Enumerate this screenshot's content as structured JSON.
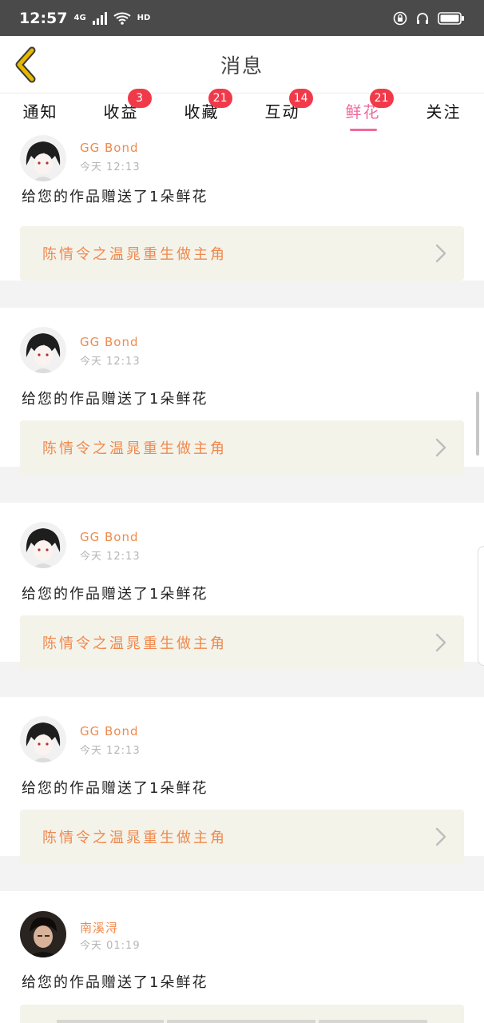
{
  "status_bar": {
    "time": "12:57",
    "network": "4G",
    "hd": "HD"
  },
  "header": {
    "title": "消息"
  },
  "tabs": [
    {
      "label": "通知",
      "badge": ""
    },
    {
      "label": "收益",
      "badge": "3"
    },
    {
      "label": "收藏",
      "badge": "21"
    },
    {
      "label": "互动",
      "badge": "14"
    },
    {
      "label": "鲜花",
      "badge": "21",
      "active": true
    },
    {
      "label": "关注",
      "badge": ""
    }
  ],
  "messages": [
    {
      "name": "GG Bond",
      "time": "今天 12:13",
      "text": "给您的作品赠送了1朵鲜花",
      "work": "陈情令之温晁重生做主角"
    },
    {
      "name": "GG Bond",
      "time": "今天 12:13",
      "text": "给您的作品赠送了1朵鲜花",
      "work": "陈情令之温晁重生做主角"
    },
    {
      "name": "GG Bond",
      "time": "今天 12:13",
      "text": "给您的作品赠送了1朵鲜花",
      "work": "陈情令之温晁重生做主角"
    },
    {
      "name": "GG Bond",
      "time": "今天 12:13",
      "text": "给您的作品赠送了1朵鲜花",
      "work": "陈情令之温晁重生做主角"
    },
    {
      "name": "南溪浔",
      "time": "今天 01:19",
      "text": "给您的作品赠送了1朵鲜花",
      "work": ""
    }
  ],
  "icons": {
    "back": "chevron-left-icon",
    "work_link": "chevron-right-icon",
    "avatar": "avatar-image"
  },
  "colors": {
    "accent": "#ef6a9c",
    "badge": "#f03a4a",
    "name": "#f08a4b",
    "work_title": "#f0894d",
    "back_arrow": "#e6b800"
  }
}
